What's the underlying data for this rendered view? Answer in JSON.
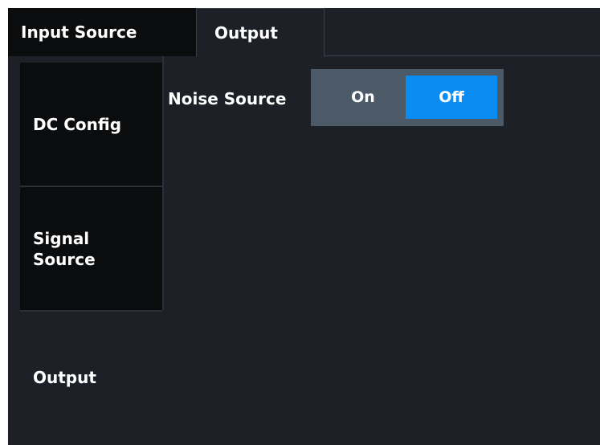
{
  "tabs": {
    "input_source": "Input Source",
    "output": "Output"
  },
  "side_tabs": {
    "dc_config": "DC Config",
    "signal_source_line1": "Signal",
    "signal_source_line2": "Source",
    "output": "Output"
  },
  "noise_source": {
    "label": "Noise Source",
    "on": "On",
    "off": "Off",
    "selected": "Off"
  },
  "colors": {
    "background": "#1d2127",
    "inactive_tab": "#0b0c0e",
    "toggle_bg": "#4c5a68",
    "selected_option": "#0a8cf2"
  }
}
